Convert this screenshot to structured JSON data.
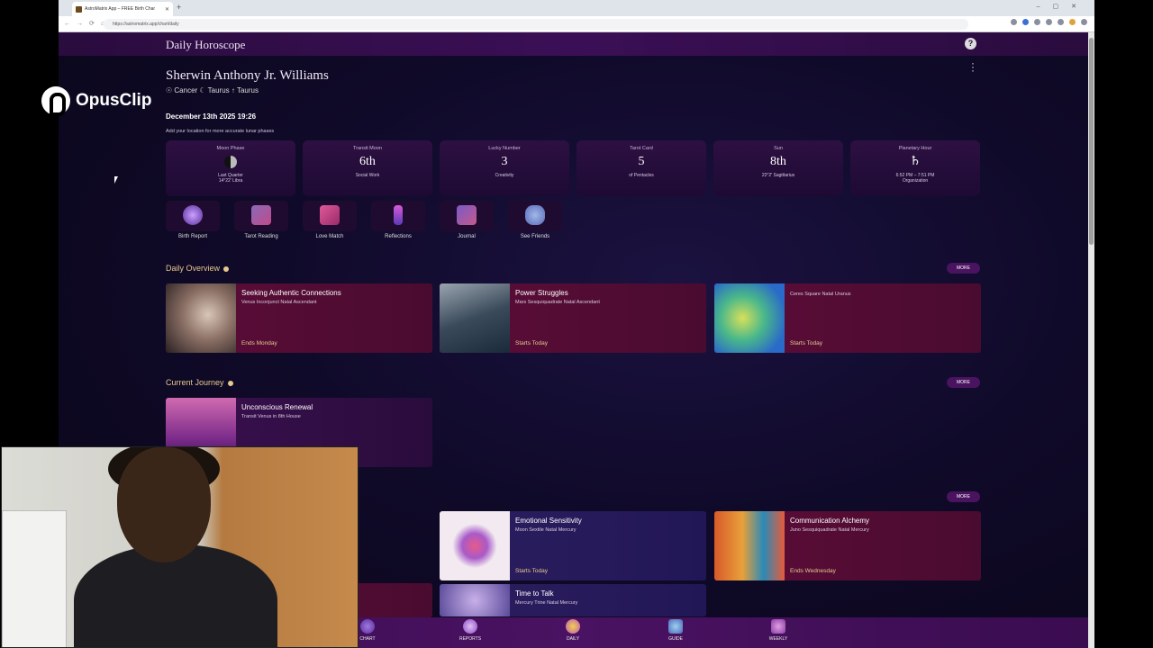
{
  "browser": {
    "tab_title": "AstroMatrix App – FREE Birth Char",
    "url": "https://astromatrix.app/chart/daily"
  },
  "overlay": {
    "brand": "OpusClip"
  },
  "app": {
    "header": "Daily Horoscope",
    "help": "?",
    "user_name": "Sherwin Anthony Jr. Williams",
    "signs": "☉ Cancer ☾ Taurus ↑ Taurus",
    "date": "December 13th 2025 19:26",
    "location_note": "Add your location for more accurate lunar phases",
    "stats": [
      {
        "label": "Moon Phase",
        "value": "",
        "sub1": "Last Quarter",
        "sub2": "14°22' Libra"
      },
      {
        "label": "Transit Moon",
        "value": "6th",
        "sub1": "Social Work",
        "sub2": ""
      },
      {
        "label": "Lucky Number",
        "value": "3",
        "sub1": "Creativity",
        "sub2": ""
      },
      {
        "label": "Tarot Card",
        "value": "5",
        "sub1": "of Pentacles",
        "sub2": ""
      },
      {
        "label": "Sun",
        "value": "8th",
        "sub1": "22°2' Sagittarius",
        "sub2": ""
      },
      {
        "label": "Planetary Hour",
        "value": "♄",
        "sub1": "6:52 PM – 7:51 PM",
        "sub2": "Organization"
      }
    ],
    "features": [
      "Birth Report",
      "Tarot Reading",
      "Love Match",
      "Reflections",
      "Journal",
      "See Friends"
    ],
    "daily_overview": {
      "title": "Daily Overview",
      "more": "MORE",
      "cards": [
        {
          "title": "Seeking Authentic Connections",
          "subtitle": "Venus Inconjunct Natal Ascendant",
          "footer": "Ends Monday"
        },
        {
          "title": "Power Struggles",
          "subtitle": "Mars Sesquiquadrate Natal Ascendant",
          "footer": "Starts Today"
        },
        {
          "title": "",
          "subtitle": "Ceres Square Natal Uranus",
          "footer": "Starts Today"
        }
      ]
    },
    "current_journey": {
      "title": "Current Journey",
      "more": "MORE",
      "cards": [
        {
          "title": "Unconscious Renewal",
          "subtitle": "Transit Venus in 8th House",
          "footer": ""
        }
      ]
    },
    "third_section": {
      "more": "MORE",
      "cards": [
        {
          "title": "Emotional Sensitivity",
          "subtitle": "Moon Sextile Natal Mercury",
          "footer": "Starts Today"
        },
        {
          "title": "Communication Alchemy",
          "subtitle": "Juno Sesquiquadrate Natal Mercury",
          "footer": "Ends Wednesday"
        },
        {
          "title": "Time to Talk",
          "subtitle": "Mercury Trine Natal Mercury",
          "footer": ""
        }
      ]
    },
    "bottom_nav": [
      "CHART",
      "REPORTS",
      "DAILY",
      "GUIDE",
      "WEEKLY"
    ]
  }
}
